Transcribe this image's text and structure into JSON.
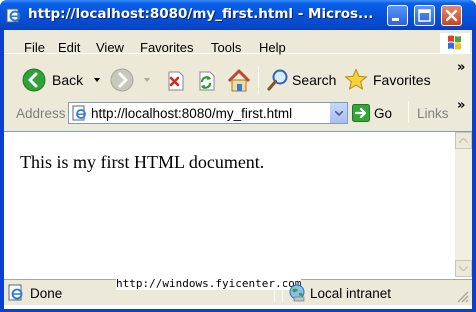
{
  "window": {
    "title": "http://localhost:8080/my_first.html - Micros..."
  },
  "menu": {
    "items": [
      "File",
      "Edit",
      "View",
      "Favorites",
      "Tools",
      "Help"
    ]
  },
  "toolbar": {
    "back_label": "Back",
    "search_label": "Search",
    "favorites_label": "Favorites"
  },
  "address": {
    "label": "Address",
    "url": "http://localhost:8080/my_first.html",
    "go_label": "Go",
    "links_label": "Links"
  },
  "content": {
    "text": "This is my first HTML document."
  },
  "status": {
    "text": "Done",
    "zone": "Local intranet",
    "watermark": "http://windows.fyicenter.com"
  },
  "colors": {
    "titlebar": "#0653d9",
    "chrome": "#ece9d8",
    "back_green": "#2fa33a"
  }
}
